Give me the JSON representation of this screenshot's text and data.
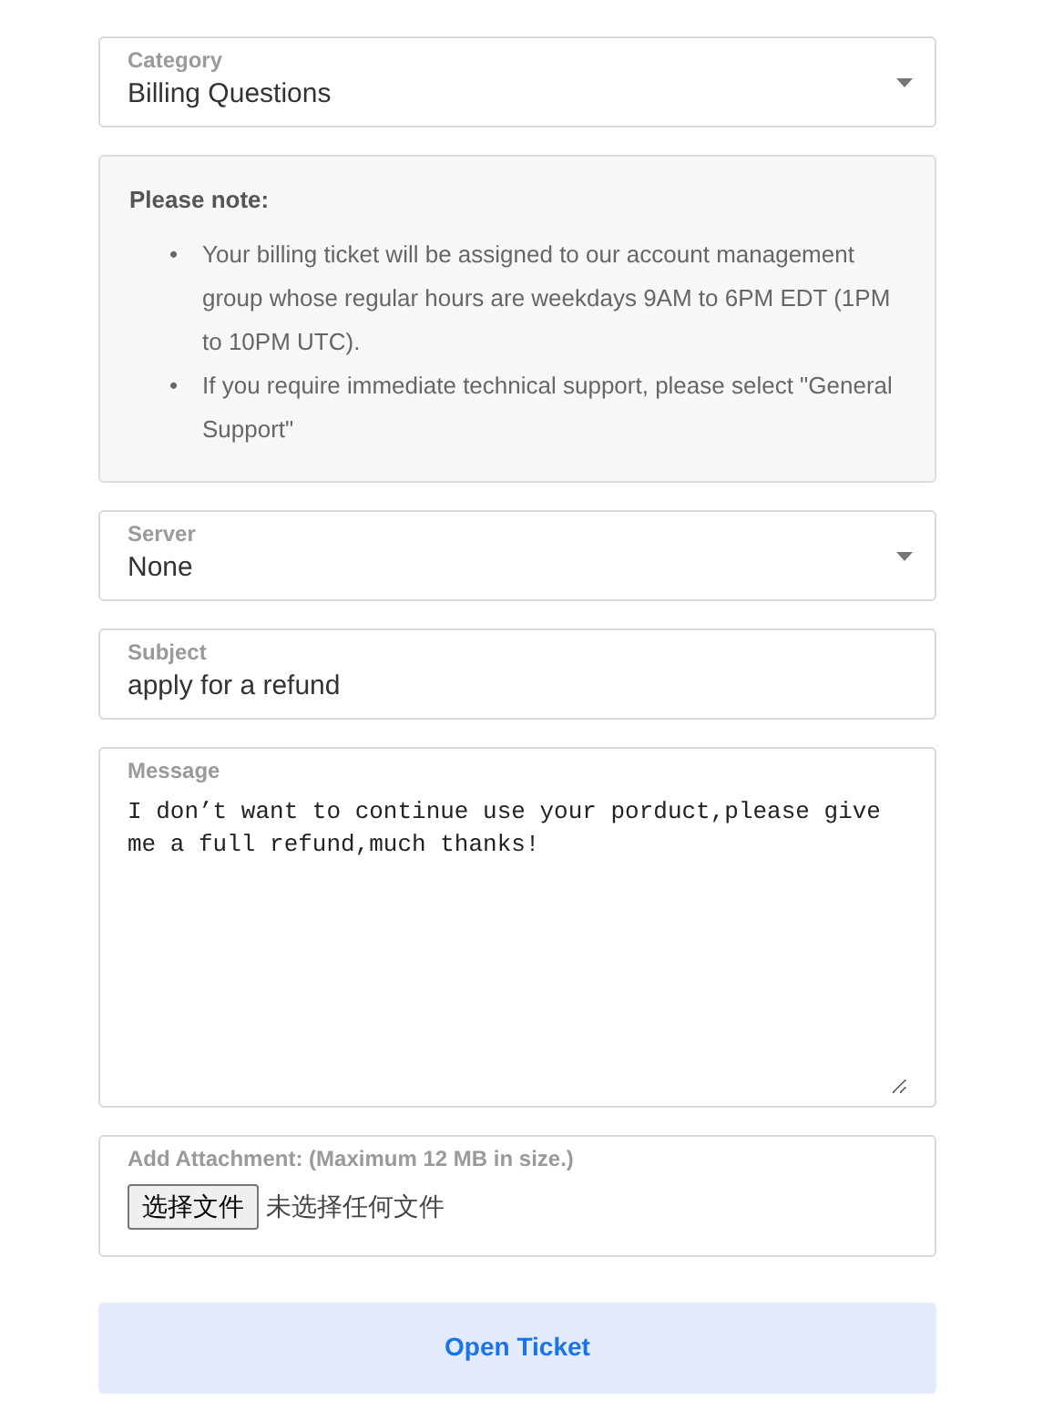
{
  "form": [
    {
      "kind": "select",
      "label": "Category",
      "value": "Billing Questions"
    },
    {
      "kind": "note",
      "title": "Please note:",
      "items": [
        {
          "marker": "•",
          "text": "Your billing ticket will be assigned to our account management group whose regular hours are weekdays 9AM to 6PM EDT (1PM to 10PM UTC)."
        },
        {
          "marker": "•",
          "text": "If you require immediate technical support, please select \"General Support\""
        }
      ]
    },
    {
      "kind": "select",
      "label": "Server",
      "value": "None"
    },
    {
      "kind": "text",
      "label": "Subject",
      "value": "apply for a refund"
    },
    {
      "kind": "textarea",
      "label": "Message",
      "value": "I don’t want to continue use your porduct,please give me a full refund,much thanks!"
    },
    {
      "kind": "file",
      "label": "Add Attachment: (Maximum 12 MB in size.)",
      "button": "选择文件",
      "status": "未选择任何文件"
    }
  ],
  "submit": "Open Ticket"
}
